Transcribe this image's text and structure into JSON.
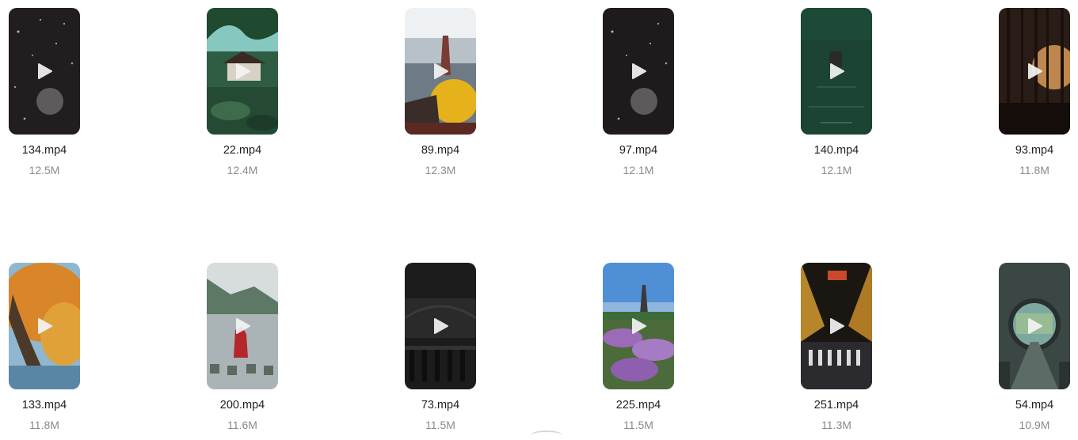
{
  "videos": [
    {
      "name": "134.mp4",
      "size": "12.5M",
      "thumb": "dark-snow-icon"
    },
    {
      "name": "22.mp4",
      "size": "12.4M",
      "thumb": "garden-pavilion-icon"
    },
    {
      "name": "89.mp4",
      "size": "12.3M",
      "thumb": "pagoda-city-icon"
    },
    {
      "name": "97.mp4",
      "size": "12.1M",
      "thumb": "dark-snow-icon"
    },
    {
      "name": "140.mp4",
      "size": "12.1M",
      "thumb": "boat-lake-icon"
    },
    {
      "name": "93.mp4",
      "size": "11.8M",
      "thumb": "forest-sunset-icon"
    },
    {
      "name": "133.mp4",
      "size": "11.8M",
      "thumb": "autumn-tree-icon"
    },
    {
      "name": "200.mp4",
      "size": "11.6M",
      "thumb": "river-red-dress-icon"
    },
    {
      "name": "73.mp4",
      "size": "11.5M",
      "thumb": "dark-bridge-icon"
    },
    {
      "name": "225.mp4",
      "size": "11.5M",
      "thumb": "pagoda-flowers-icon"
    },
    {
      "name": "251.mp4",
      "size": "11.3M",
      "thumb": "night-street-icon"
    },
    {
      "name": "54.mp4",
      "size": "10.9M",
      "thumb": "moon-gate-icon"
    }
  ]
}
